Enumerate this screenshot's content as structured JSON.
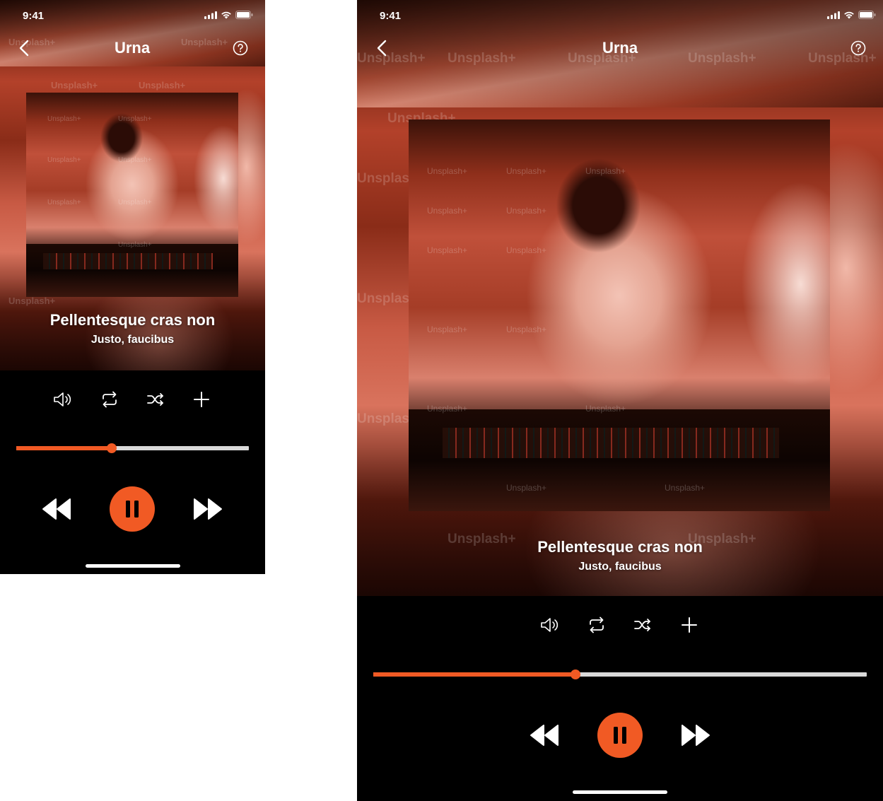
{
  "status_bar": {
    "time": "9:41"
  },
  "nav": {
    "title": "Urna"
  },
  "watermark": "Unsplash+",
  "song": {
    "title": "Pellentesque cras non",
    "subtitle": "Justo, faucibus"
  },
  "playback": {
    "progress_fraction": 0.41,
    "state": "playing"
  },
  "icons": {
    "back": "chevron-left-icon",
    "help": "help-circle-icon",
    "volume": "volume-icon",
    "repeat": "repeat-icon",
    "shuffle": "shuffle-icon",
    "add": "plus-icon",
    "previous": "rewind-icon",
    "pause": "pause-icon",
    "next": "fast-forward-icon"
  },
  "colors": {
    "accent": "#f15a24",
    "track": "#d9d9d9",
    "background": "#000000"
  }
}
